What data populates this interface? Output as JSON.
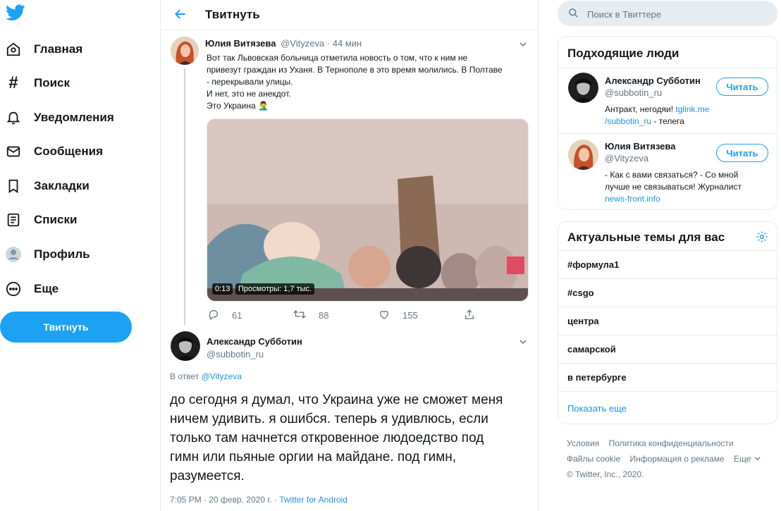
{
  "nav": {
    "items": [
      {
        "label": "Главная",
        "icon": "home-icon"
      },
      {
        "label": "Поиск",
        "icon": "hashtag-icon"
      },
      {
        "label": "Уведомления",
        "icon": "bell-icon"
      },
      {
        "label": "Сообщения",
        "icon": "mail-icon"
      },
      {
        "label": "Закладки",
        "icon": "bookmark-icon"
      },
      {
        "label": "Списки",
        "icon": "list-icon"
      },
      {
        "label": "Профиль",
        "icon": "profile-icon"
      },
      {
        "label": "Еще",
        "icon": "more-icon"
      }
    ],
    "tweet_button": "Твитнуть"
  },
  "header": {
    "title": "Твитнуть"
  },
  "main_tweet": {
    "name": "Юлия Витязева",
    "handle": "@Vityzeva",
    "time": "· 44 мин",
    "lines": [
      "Вот так Львовская больница отметила новость о том, что к ним не",
      "привезут граждан из Уханя. В Тернополе в это время молились. В Полтаве",
      "- перекрывали улицы.",
      "И нет, это не анекдот.",
      "Это Украина 🤦‍♂️"
    ],
    "video": {
      "duration": "0:13",
      "views": "Просмотры: 1,7 тыс."
    },
    "replies": "61",
    "retweets": "88",
    "likes": "155"
  },
  "reply_tweet": {
    "name": "Александр Субботин",
    "handle": "@subbotin_ru",
    "reply_prefix": "В ответ",
    "reply_to": "@Vityzeva",
    "lines": [
      "до сегодня я думал, что Украина уже не сможет меня",
      "ничем удивить. я ошибся. теперь я удивлюсь, если",
      "только там начнется откровенное людоедство под",
      "гимн или пьяные оргии на майдане. под гимн,",
      "разумеется."
    ],
    "meta": "7:05 PM · 20 февр. 2020 г. · ",
    "source": "Twitter for Android"
  },
  "search": {
    "placeholder": "Поиск в Твиттере"
  },
  "who_to_follow": {
    "title": "Подходящие люди",
    "people": [
      {
        "name": "Александр Субботин",
        "handle": "@subbotin_ru",
        "follow_label": "Читать",
        "bio_text": "Антракт, негодяи! ",
        "bio_link1": "tglink.me",
        "bio_link2": "/subbotin_ru",
        "bio_tail": " - телега"
      },
      {
        "name": "Юлия Витязева",
        "handle": "@Vityzeva",
        "follow_label": "Читать",
        "bio_line1": "- Как с вами связаться? - Со мной",
        "bio_line2": "лучше не связываться! Журналист",
        "bio_link": "news-front.info"
      }
    ]
  },
  "trends": {
    "title": "Актуальные темы для вас",
    "items": [
      "#формула1",
      "#csgo",
      "центра",
      "самарской",
      "в петербурге"
    ],
    "show_more": "Показать еще"
  },
  "footer": {
    "terms": "Условия",
    "privacy": "Политика конфиденциальности",
    "cookies": "Файлы cookie",
    "ads": "Информация о рекламе",
    "more": "Еще",
    "copyright": "© Twitter, Inc., 2020."
  },
  "colors": {
    "accent": "#1da1f2",
    "link": "#1b95e0",
    "text": "#14171a",
    "muted": "#657786",
    "border": "#e6ecf0"
  }
}
